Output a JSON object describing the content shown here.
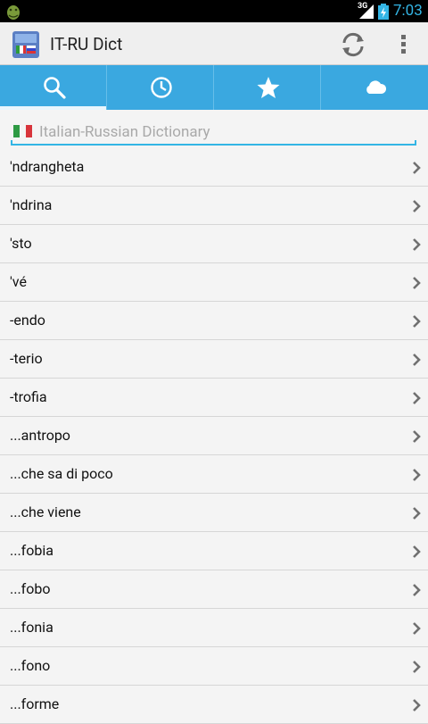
{
  "status_bar": {
    "network": "3G",
    "time": "7:03"
  },
  "app": {
    "title": "IT-RU Dict"
  },
  "tabs": [
    {
      "name": "search",
      "icon": "search-icon",
      "active": true
    },
    {
      "name": "history",
      "icon": "clock-icon",
      "active": false
    },
    {
      "name": "favorites",
      "icon": "star-icon",
      "active": false
    },
    {
      "name": "cloud",
      "icon": "cloud-icon",
      "active": false
    }
  ],
  "search": {
    "placeholder": "Italian-Russian Dictionary",
    "value": ""
  },
  "words": [
    "'ndrangheta",
    "'ndrina",
    "'sto",
    "'vé",
    "-endo",
    "-terio",
    "-trofia",
    "...antropo",
    "...che sa di poco",
    "...che viene",
    "...fobia",
    "...fobo",
    "...fonia",
    "...fono",
    "...forme"
  ],
  "colors": {
    "accent": "#3aa8e0",
    "clock": "#33b5e5",
    "underline": "#33b5e5"
  }
}
